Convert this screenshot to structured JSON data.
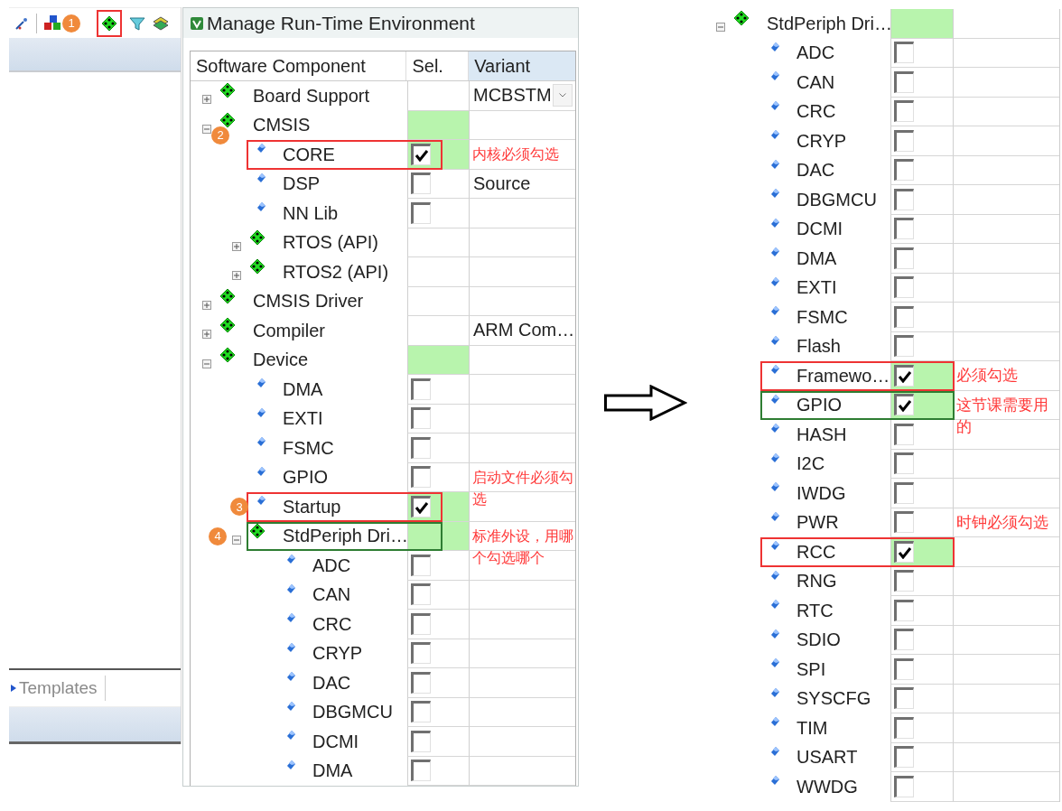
{
  "ide": {
    "toolbar": {
      "badge": "1",
      "color": "#ee3333"
    },
    "tab": "Templates"
  },
  "dialog": {
    "title": "Manage Run-Time Environment",
    "columns": [
      "Software Component",
      "Sel.",
      "Variant"
    ],
    "tree": [
      {
        "name": "Board Support",
        "expanded": false,
        "active": false,
        "variant": "MCBSTM",
        "dropdown": true
      },
      {
        "name": "CMSIS",
        "expanded": true,
        "active": true,
        "badge": "2",
        "children": [
          {
            "name": "CORE",
            "checked": true,
            "color": "#ee3333",
            "note": "内核必须勾选"
          },
          {
            "name": "DSP",
            "checked": false,
            "variant": "Source"
          },
          {
            "name": "NN Lib",
            "checked": false
          },
          {
            "name": "RTOS (API)",
            "expanded": false,
            "active": false
          },
          {
            "name": "RTOS2 (API)",
            "expanded": false,
            "active": false
          }
        ]
      },
      {
        "name": "CMSIS Driver",
        "expanded": false,
        "active": false
      },
      {
        "name": "Compiler",
        "expanded": false,
        "active": false,
        "variant": "ARM Com…"
      },
      {
        "name": "Device",
        "expanded": true,
        "active": true,
        "children": [
          {
            "name": "DMA",
            "checked": false
          },
          {
            "name": "EXTI",
            "checked": false
          },
          {
            "name": "FSMC",
            "checked": false
          },
          {
            "name": "GPIO",
            "checked": false,
            "note": "启动文件必须勾选"
          },
          {
            "name": "Startup",
            "checked": true,
            "color": "#ee3333",
            "badge": "3"
          },
          {
            "name": "StdPeriph Dri…",
            "expanded": true,
            "active": true,
            "color": "#2e7d32",
            "badge": "4",
            "note": "标准外设，用哪个勾选哪个",
            "children": [
              {
                "name": "ADC",
                "checked": false
              },
              {
                "name": "CAN",
                "checked": false
              },
              {
                "name": "CRC",
                "checked": false
              },
              {
                "name": "CRYP",
                "checked": false
              },
              {
                "name": "DAC",
                "checked": false
              },
              {
                "name": "DBGMCU",
                "checked": false
              },
              {
                "name": "DCMI",
                "checked": false
              },
              {
                "name": "DMA",
                "checked": false
              }
            ]
          }
        ]
      }
    ]
  },
  "right_panel": {
    "tree": [
      {
        "name": "StdPeriph Dri…",
        "expanded": true,
        "active": true,
        "children": [
          {
            "name": "ADC",
            "checked": false
          },
          {
            "name": "CAN",
            "checked": false
          },
          {
            "name": "CRC",
            "checked": false
          },
          {
            "name": "CRYP",
            "checked": false
          },
          {
            "name": "DAC",
            "checked": false
          },
          {
            "name": "DBGMCU",
            "checked": false
          },
          {
            "name": "DCMI",
            "checked": false
          },
          {
            "name": "DMA",
            "checked": false
          },
          {
            "name": "EXTI",
            "checked": false
          },
          {
            "name": "FSMC",
            "checked": false
          },
          {
            "name": "Flash",
            "checked": false
          },
          {
            "name": "Framewo…",
            "checked": true,
            "color": "#ee3333",
            "note": "必须勾选"
          },
          {
            "name": "GPIO",
            "checked": true,
            "color": "#2e7d32",
            "note": "这节课需要用的"
          },
          {
            "name": "HASH",
            "checked": false
          },
          {
            "name": "I2C",
            "checked": false
          },
          {
            "name": "IWDG",
            "checked": false
          },
          {
            "name": "PWR",
            "checked": false,
            "note": "时钟必须勾选"
          },
          {
            "name": "RCC",
            "checked": true,
            "color": "#ee3333"
          },
          {
            "name": "RNG",
            "checked": false
          },
          {
            "name": "RTC",
            "checked": false
          },
          {
            "name": "SDIO",
            "checked": false
          },
          {
            "name": "SPI",
            "checked": false
          },
          {
            "name": "SYSCFG",
            "checked": false
          },
          {
            "name": "TIM",
            "checked": false
          },
          {
            "name": "USART",
            "checked": false
          },
          {
            "name": "WWDG",
            "checked": false
          }
        ]
      }
    ]
  }
}
